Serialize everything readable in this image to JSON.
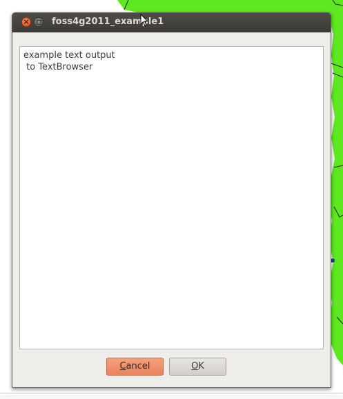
{
  "window": {
    "title": "foss4g2011_example1"
  },
  "text_browser": {
    "lines": [
      "example text output",
      " to TextBrowser"
    ]
  },
  "buttons": {
    "cancel": {
      "mnemonic": "C",
      "rest": "ancel"
    },
    "ok": {
      "mnemonic": "O",
      "rest": "K"
    }
  },
  "icons": {
    "close": "close-icon",
    "maximize": "maximize-icon",
    "cursor": "mouse-pointer-icon"
  },
  "colors": {
    "map_green": "#5de81f",
    "map_lines": "#222222",
    "titlebar": "#3c3b37",
    "cancel_button": "#ea865f"
  }
}
